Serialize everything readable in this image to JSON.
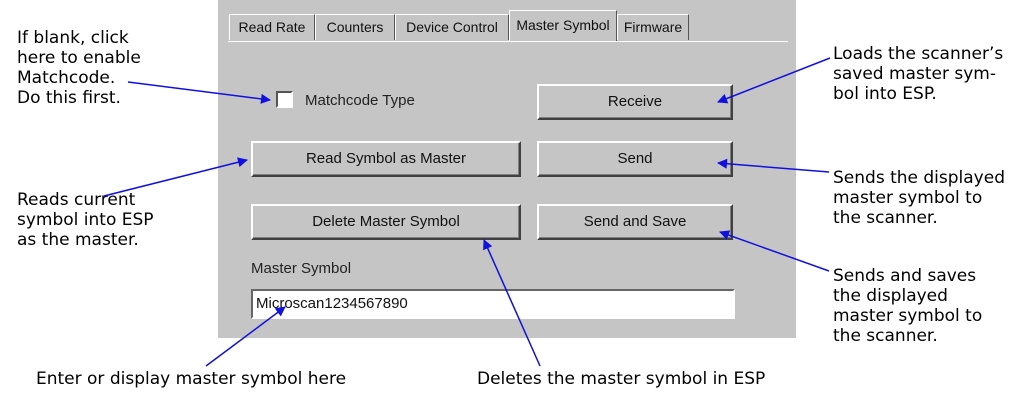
{
  "tabs": [
    "Read Rate",
    "Counters",
    "Device Control",
    "Master Symbol",
    "Firmware"
  ],
  "active_tab": "Master Symbol",
  "form": {
    "checkbox_label": "Matchcode Type",
    "checkbox_checked": false,
    "receive_label": "Receive",
    "read_master_label": "Read Symbol as Master",
    "send_label": "Send",
    "delete_master_label": "Delete Master Symbol",
    "send_save_label": "Send and Save",
    "master_symbol_label": "Master Symbol",
    "master_symbol_value": "Microscan1234567890"
  },
  "callouts": {
    "enable_matchcode": "If blank, click\nhere to enable\nMatchcode.\nDo this first.",
    "read_current": "Reads current\nsymbol into ESP\nas the master.",
    "enter_display": "Enter or display master symbol here",
    "deletes": "Deletes the master symbol in ESP",
    "loads": "Loads the scanner’s\nsaved master sym-\nbol into ESP.",
    "sends": "Sends the displayed\nmaster symbol to\nthe scanner.",
    "sends_saves": "Sends and saves\nthe displayed\nmaster symbol to\nthe scanner."
  },
  "colors": {
    "arrow": "#1010e0",
    "panel": "#c5c5c5"
  }
}
